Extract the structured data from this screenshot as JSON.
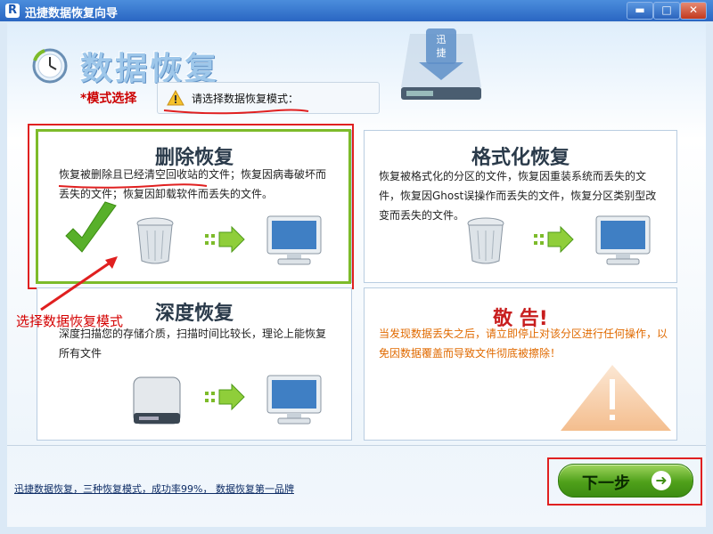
{
  "window": {
    "title": "迅捷数据恢复向导",
    "app_icon_letter": "R",
    "controls": {
      "minimize": "▬",
      "maximize": "□",
      "close": "✕"
    }
  },
  "header": {
    "title": "数据恢复",
    "drive_label_1": "迅",
    "drive_label_2": "捷",
    "mode_label": "*模式选择",
    "hint": "请选择数据恢复模式："
  },
  "cards": [
    {
      "title": "删除恢复",
      "description": "恢复被删除且已经清空回收站的文件；恢复因病毒破坏而丢失的文件；恢复因卸载软件而丢失的文件。",
      "selected": true
    },
    {
      "title": "格式化恢复",
      "description": "恢复被格式化的分区的文件，恢复因重装系统而丢失的文件，恢复因Ghost误操作而丢失的文件，恢复分区类别型改变而丢失的文件。",
      "selected": false
    },
    {
      "title": "深度恢复",
      "description": "深度扫描您的存储介质，扫描时间比较长，理论上能恢复所有文件",
      "selected": false
    }
  ],
  "warning": {
    "title": "敬 告!",
    "text": "当发现数据丢失之后，请立即停止对该分区进行任何操作，以免因数据覆盖而导致文件彻底被擦除！"
  },
  "annotation": "选择数据恢复模式",
  "footer": {
    "link": "迅捷数据恢复，三种恢复模式，成功率99%， 数据恢复第一品牌",
    "next_label": "下一步"
  },
  "colors": {
    "accent_green": "#7dbb2a",
    "annotation_red": "#e02020",
    "title_bar": "#2a66c2"
  }
}
